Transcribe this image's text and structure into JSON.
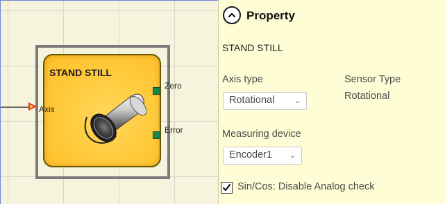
{
  "block": {
    "title": "STAND STILL",
    "input_axis_label": "Axis",
    "output_zero_label": "Zero",
    "output_error_label": "Error",
    "icon": "rotating-cylinder-icon"
  },
  "property_panel": {
    "title": "Property",
    "collapse_icon": "chevron-up-circle-icon",
    "subtitle": "STAND STILL",
    "axis_type": {
      "label": "Axis type",
      "value": "Rotational"
    },
    "sensor_type": {
      "label": "Sensor Type",
      "value": "Rotational"
    },
    "measuring_device": {
      "label": "Measuring device",
      "value": "Encoder1"
    },
    "sincos_check": {
      "label": "Sin/Cos: Disable Analog check",
      "checked": true
    }
  },
  "colors": {
    "canvas_bg": "#f6f4dc",
    "block_fill": "#ffc93a",
    "panel_bg": "#fffdd5",
    "input_port": "#e3322e",
    "output_port": "#18874a"
  }
}
